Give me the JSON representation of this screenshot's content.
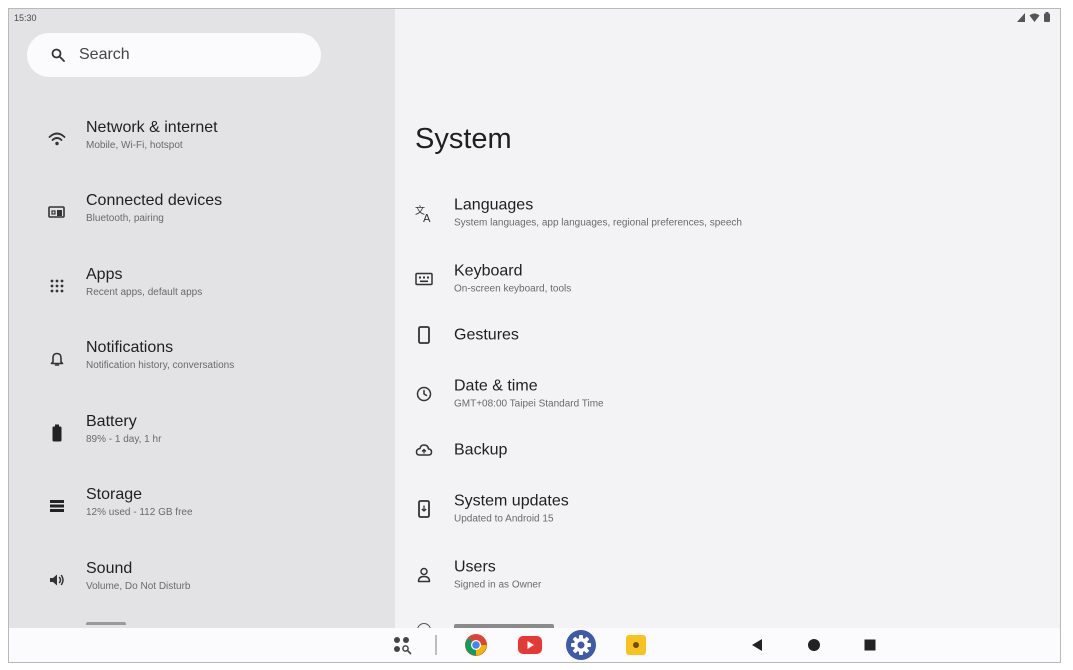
{
  "status": {
    "time": "15:30"
  },
  "search": {
    "placeholder": "Search"
  },
  "sidebar": {
    "items": [
      {
        "title": "Network & internet",
        "subtitle": "Mobile, Wi-Fi, hotspot",
        "icon": "wifi-icon"
      },
      {
        "title": "Connected devices",
        "subtitle": "Bluetooth, pairing",
        "icon": "connected-devices-icon"
      },
      {
        "title": "Apps",
        "subtitle": "Recent apps, default apps",
        "icon": "apps-grid-icon"
      },
      {
        "title": "Notifications",
        "subtitle": "Notification history, conversations",
        "icon": "bell-icon"
      },
      {
        "title": "Battery",
        "subtitle": "89% - 1 day, 1 hr",
        "icon": "battery-icon"
      },
      {
        "title": "Storage",
        "subtitle": "12% used - 112 GB free",
        "icon": "storage-icon"
      },
      {
        "title": "Sound",
        "subtitle": "Volume, Do Not Disturb",
        "icon": "volume-icon"
      }
    ]
  },
  "main": {
    "title": "System",
    "items": [
      {
        "title": "Languages",
        "subtitle": "System languages, app languages, regional preferences, speech",
        "icon": "translate-icon"
      },
      {
        "title": "Keyboard",
        "subtitle": "On-screen keyboard, tools",
        "icon": "keyboard-icon"
      },
      {
        "title": "Gestures",
        "subtitle": "",
        "icon": "gestures-phone-icon"
      },
      {
        "title": "Date & time",
        "subtitle": "GMT+08:00 Taipei Standard Time",
        "icon": "clock-icon"
      },
      {
        "title": "Backup",
        "subtitle": "",
        "icon": "cloud-backup-icon"
      },
      {
        "title": "System updates",
        "subtitle": "Updated to Android 15",
        "icon": "system-update-icon"
      },
      {
        "title": "Users",
        "subtitle": "Signed in as Owner",
        "icon": "user-icon"
      }
    ]
  },
  "colors": {
    "sidebar_bg": "#e3e3e6",
    "content_bg": "#f3f3f6",
    "search_bg": "#fbfbfd",
    "settings_accent": "#3f5aa6"
  }
}
